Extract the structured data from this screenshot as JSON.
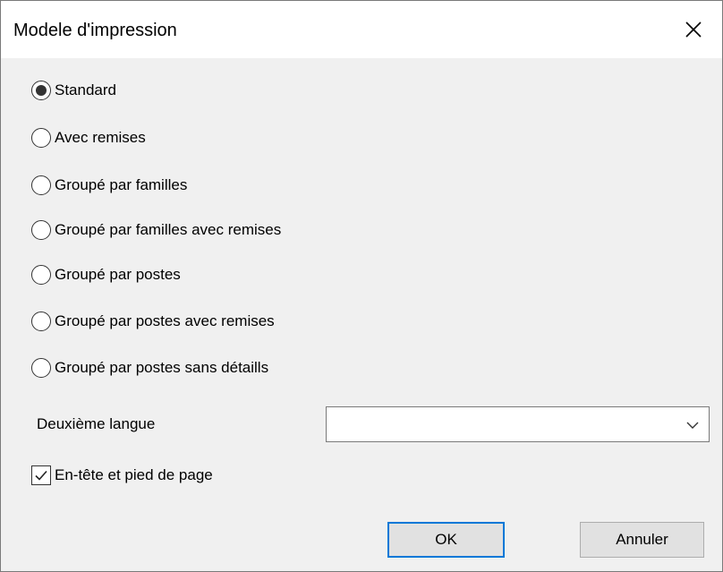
{
  "window": {
    "title": "Modele d'impression",
    "close_icon": "close-icon"
  },
  "templates": {
    "selected_index": 0,
    "options": [
      {
        "label": "Standard",
        "selected": true
      },
      {
        "label": "Avec remises",
        "selected": false
      },
      {
        "label": "Groupé par familles",
        "selected": false
      },
      {
        "label": "Groupé par familles avec remises",
        "selected": false
      },
      {
        "label": "Groupé par postes",
        "selected": false
      },
      {
        "label": "Groupé par postes avec remises",
        "selected": false
      },
      {
        "label": "Groupé par postes sans détaills",
        "selected": false
      }
    ]
  },
  "second_language": {
    "label": "Deuxième langue",
    "value": ""
  },
  "header_footer": {
    "label": "En-tête et pied de page",
    "checked": true
  },
  "buttons": {
    "ok_label": "OK",
    "cancel_label": "Annuler"
  },
  "colors": {
    "default_button_border": "#0078d7",
    "dialog_background": "#f0f0f0"
  }
}
